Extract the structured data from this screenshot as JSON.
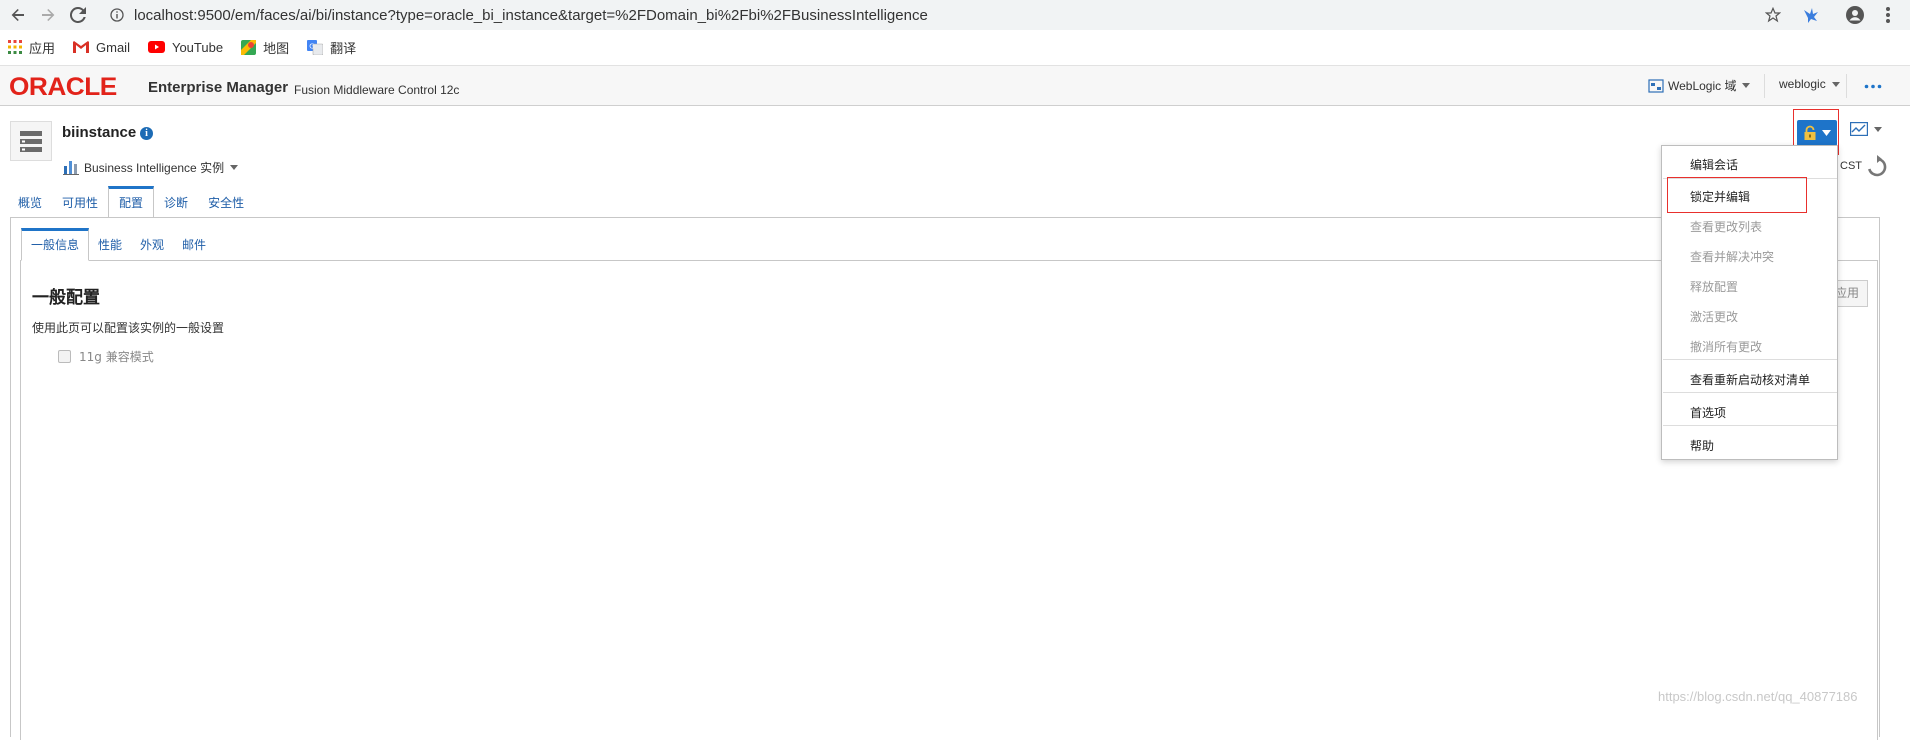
{
  "browser": {
    "url": "localhost:9500/em/faces/ai/bi/instance?type=oracle_bi_instance&target=%2FDomain_bi%2Fbi%2FBusinessIntelligence",
    "bookmarks": [
      {
        "label": "应用",
        "icon": "apps-grid-icon"
      },
      {
        "label": "Gmail",
        "icon": "gmail-icon"
      },
      {
        "label": "YouTube",
        "icon": "youtube-icon"
      },
      {
        "label": "地图",
        "icon": "maps-icon"
      },
      {
        "label": "翻译",
        "icon": "translate-icon"
      }
    ]
  },
  "header": {
    "logo": "ORACLE",
    "title": "Enterprise Manager",
    "subtitle": "Fusion Middleware Control 12c",
    "domain_menu": "WebLogic 域",
    "user_menu": "weblogic"
  },
  "target": {
    "name": "biinstance",
    "type_menu": "Business Intelligence 实例",
    "timezone": "CST"
  },
  "tabs": [
    "概览",
    "可用性",
    "配置",
    "诊断",
    "安全性"
  ],
  "active_tab": "配置",
  "subtabs": [
    "一般信息",
    "性能",
    "外观",
    "邮件"
  ],
  "active_subtab": "一般信息",
  "main": {
    "title": "一般配置",
    "description": "使用此页可以配置该实例的一般设置",
    "compat_checkbox_label": "11g 兼容模式",
    "apply_button": "应用"
  },
  "menu": {
    "items": [
      {
        "label": "编辑会话",
        "enabled": true
      },
      {
        "label": "锁定并编辑",
        "enabled": true
      },
      {
        "label": "查看更改列表",
        "enabled": false
      },
      {
        "label": "查看并解决冲突",
        "enabled": false
      },
      {
        "label": "释放配置",
        "enabled": false
      },
      {
        "label": "激活更改",
        "enabled": false
      },
      {
        "label": "撤消所有更改",
        "enabled": false
      },
      {
        "label": "查看重新启动核对清单",
        "enabled": true
      },
      {
        "label": "首选项",
        "enabled": true
      },
      {
        "label": "帮助",
        "enabled": true
      }
    ]
  },
  "colors": {
    "oracle_red": "#e2231a",
    "accent_blue": "#1e74c9",
    "highlight_red": "#e8302d"
  },
  "watermark": "https://blog.csdn.net/qq_40877186"
}
